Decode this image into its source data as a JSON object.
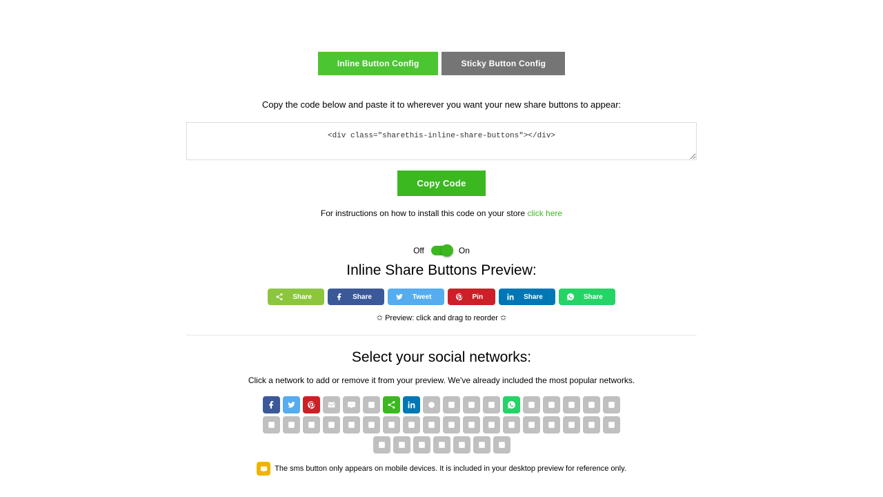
{
  "tabs": {
    "inline": "Inline Button Config",
    "sticky": "Sticky Button Config"
  },
  "instruction": "Copy the code below and paste it to wherever you want your new share buttons to appear:",
  "code_snippet": "<div class=\"sharethis-inline-share-buttons\"></div>",
  "copy_button": "Copy Code",
  "install_prefix": "For instructions on how to install this code on your store ",
  "install_link": "click here",
  "toggle": {
    "off": "Off",
    "on": "On"
  },
  "preview_title": "Inline Share Buttons Preview:",
  "preview_buttons": [
    {
      "name": "sharethis",
      "label": "Share",
      "color": "#8cc63f"
    },
    {
      "name": "facebook",
      "label": "Share",
      "color": "#3b5998"
    },
    {
      "name": "twitter",
      "label": "Tweet",
      "color": "#55acee"
    },
    {
      "name": "pinterest",
      "label": "Pin",
      "color": "#cb2027"
    },
    {
      "name": "linkedin",
      "label": "Share",
      "color": "#0077b5"
    },
    {
      "name": "whatsapp",
      "label": "Share",
      "color": "#25d366"
    }
  ],
  "preview_hint": "✩ Preview: click and drag to reorder ✩",
  "select_title": "Select your social networks:",
  "select_subtitle": "Click a network to add or remove it from your preview. We've already included the most popular networks.",
  "networks": [
    {
      "n": "facebook",
      "active": true,
      "color": "#3b5998"
    },
    {
      "n": "twitter",
      "active": true,
      "color": "#55acee"
    },
    {
      "n": "pinterest",
      "active": true,
      "color": "#cb2027"
    },
    {
      "n": "email",
      "active": false
    },
    {
      "n": "sms",
      "active": false
    },
    {
      "n": "messenger",
      "active": false
    },
    {
      "n": "sharethis",
      "active": true,
      "color": "#3bb820"
    },
    {
      "n": "linkedin",
      "active": true,
      "color": "#0077b5"
    },
    {
      "n": "reddit",
      "active": false
    },
    {
      "n": "tumblr",
      "active": false
    },
    {
      "n": "digg",
      "active": false
    },
    {
      "n": "stumbleupon",
      "active": false
    },
    {
      "n": "whatsapp",
      "active": true,
      "color": "#25d366"
    },
    {
      "n": "vk",
      "active": false
    },
    {
      "n": "weibo",
      "active": false
    },
    {
      "n": "odnoklassniki",
      "active": false
    },
    {
      "n": "xing",
      "active": false
    },
    {
      "n": "print",
      "active": false
    },
    {
      "n": "blogger",
      "active": false
    },
    {
      "n": "flipboard",
      "active": false
    },
    {
      "n": "meneame",
      "active": false
    },
    {
      "n": "mailru",
      "active": false
    },
    {
      "n": "delicious",
      "active": false
    },
    {
      "n": "buffer",
      "active": false
    },
    {
      "n": "diaspora",
      "active": false
    },
    {
      "n": "douban",
      "active": false
    },
    {
      "n": "evernote",
      "active": false
    },
    {
      "n": "googlebookmarks",
      "active": false
    },
    {
      "n": "gmail",
      "active": false
    },
    {
      "n": "hackernews",
      "active": false
    },
    {
      "n": "instapaper",
      "active": false
    },
    {
      "n": "line",
      "active": false
    },
    {
      "n": "pocket",
      "active": false
    },
    {
      "n": "qzone",
      "active": false
    },
    {
      "n": "refind",
      "active": false
    },
    {
      "n": "renren",
      "active": false
    },
    {
      "n": "surfingbird",
      "active": false
    },
    {
      "n": "skype",
      "active": false
    },
    {
      "n": "telegram",
      "active": false
    },
    {
      "n": "threema",
      "active": false
    },
    {
      "n": "yahoomail",
      "active": false
    },
    {
      "n": "wordpress",
      "active": false
    },
    {
      "n": "wechat",
      "active": false
    }
  ],
  "sms_note": "The sms button only appears on mobile devices. It is included in your desktop preview for reference only."
}
